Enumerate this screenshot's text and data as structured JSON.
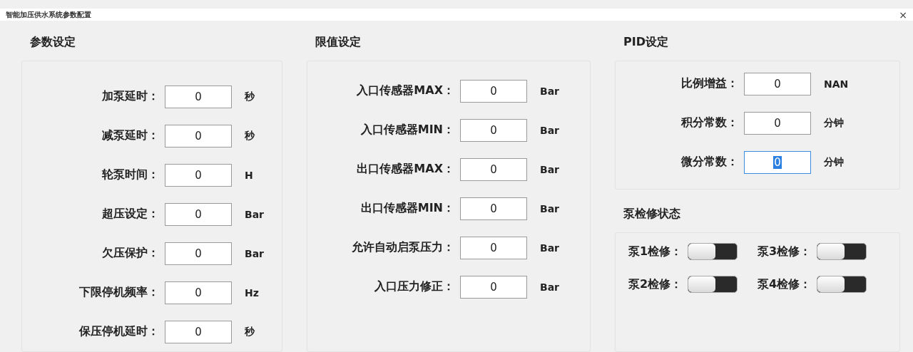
{
  "window": {
    "title": "智能加压供水系统参数配置",
    "close": "×"
  },
  "groups": [
    {
      "title": "参数设定",
      "fields": [
        {
          "label": "加泵延时：",
          "value": "0",
          "unit": "秒",
          "focused": false
        },
        {
          "label": "减泵延时：",
          "value": "0",
          "unit": "秒",
          "focused": false
        },
        {
          "label": "轮泵时间：",
          "value": "0",
          "unit": "H",
          "focused": false
        },
        {
          "label": "超压设定：",
          "value": "0",
          "unit": "Bar",
          "focused": false
        },
        {
          "label": "欠压保护：",
          "value": "0",
          "unit": "Bar",
          "focused": false
        },
        {
          "label": "下限停机频率：",
          "value": "0",
          "unit": "Hz",
          "focused": false
        },
        {
          "label": "保压停机延时：",
          "value": "0",
          "unit": "秒",
          "focused": false
        }
      ]
    },
    {
      "title": "限值设定",
      "fields": [
        {
          "label": "入口传感器MAX：",
          "value": "0",
          "unit": "Bar",
          "focused": false
        },
        {
          "label": "入口传感器MIN：",
          "value": "0",
          "unit": "Bar",
          "focused": false
        },
        {
          "label": "出口传感器MAX：",
          "value": "0",
          "unit": "Bar",
          "focused": false
        },
        {
          "label": "出口传感器MIN：",
          "value": "0",
          "unit": "Bar",
          "focused": false
        },
        {
          "label": "允许自动启泵压力：",
          "value": "0",
          "unit": "Bar",
          "focused": false
        },
        {
          "label": "入口压力修正：",
          "value": "0",
          "unit": "Bar",
          "focused": false
        }
      ]
    },
    {
      "title": "PID设定",
      "fields": [
        {
          "label": "比例增益：",
          "value": "0",
          "unit": "NAN",
          "focused": false
        },
        {
          "label": "积分常数：",
          "value": "0",
          "unit": "分钟",
          "focused": false
        },
        {
          "label": "微分常数：",
          "value": "0",
          "unit": "分钟",
          "focused": true
        }
      ]
    }
  ],
  "maintenance": {
    "title": "泵检修状态",
    "switches": [
      {
        "label": "泵1检修：",
        "on": false
      },
      {
        "label": "泵3检修：",
        "on": false
      },
      {
        "label": "泵2检修：",
        "on": false
      },
      {
        "label": "泵4检修：",
        "on": false
      }
    ]
  }
}
